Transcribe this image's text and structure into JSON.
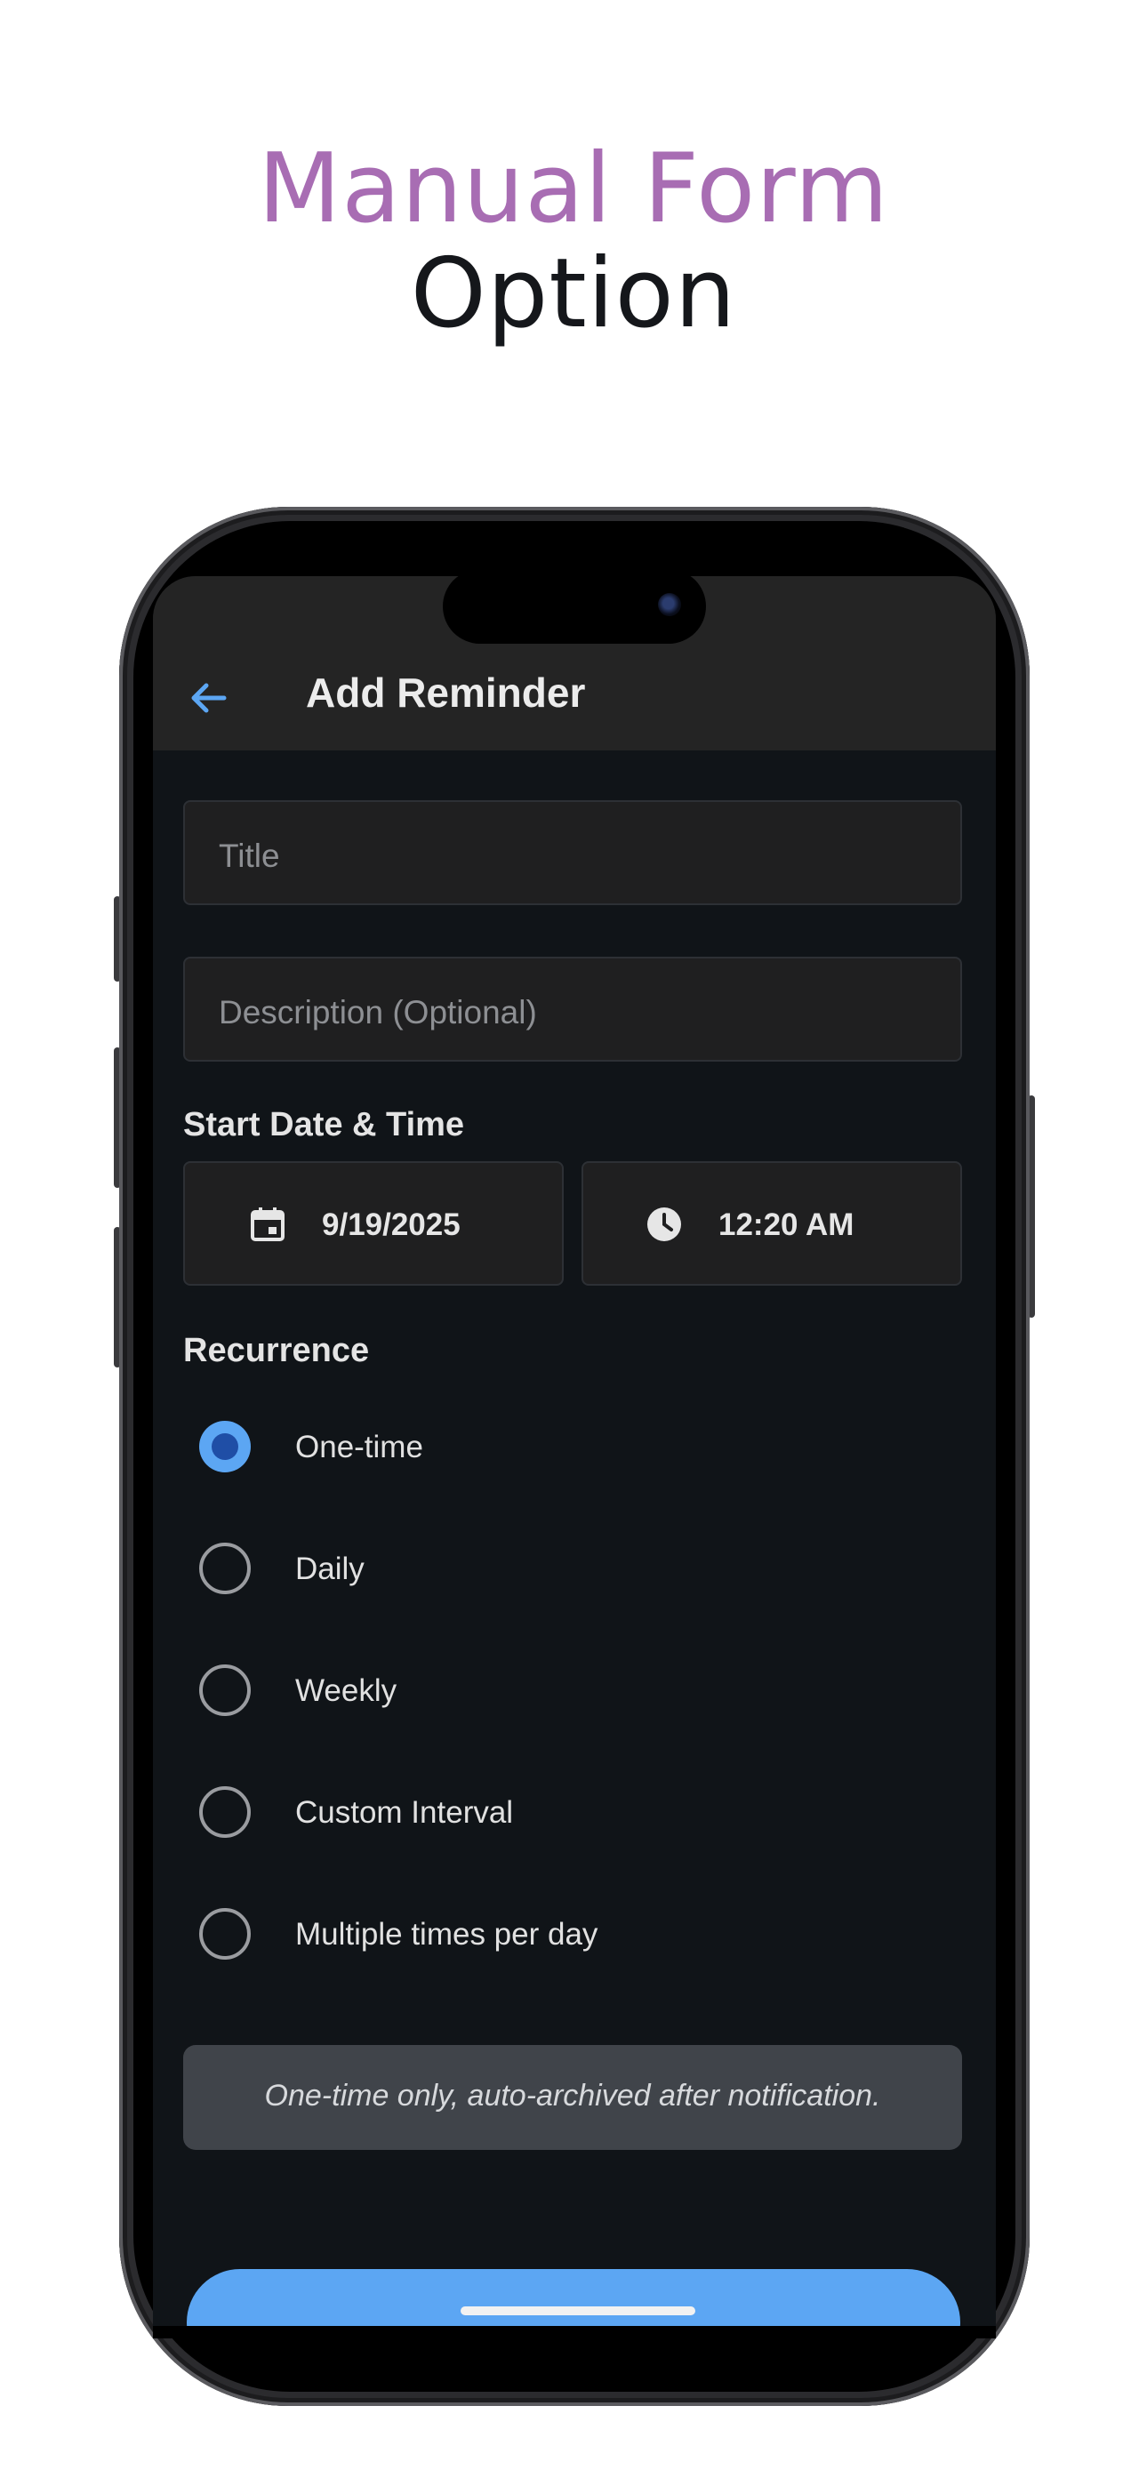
{
  "headline": {
    "line1": "Manual Form",
    "line2": "Option"
  },
  "colors": {
    "accent": "#5CA6F3",
    "headline_purple": "#A86DB3",
    "background": "#101418",
    "appbar": "#242424"
  },
  "appbar": {
    "back_icon": "arrow-left-icon",
    "title": "Add Reminder"
  },
  "form": {
    "title_placeholder": "Title",
    "description_placeholder": "Description (Optional)",
    "start_label": "Start Date & Time",
    "date": {
      "icon": "calendar-icon",
      "value": "9/19/2025"
    },
    "time": {
      "icon": "clock-icon",
      "value": "12:20 AM"
    },
    "recurrence_label": "Recurrence",
    "recurrence_options": [
      {
        "label": "One-time",
        "selected": true
      },
      {
        "label": "Daily",
        "selected": false
      },
      {
        "label": "Weekly",
        "selected": false
      },
      {
        "label": "Custom Interval",
        "selected": false
      },
      {
        "label": "Multiple times per day",
        "selected": false
      }
    ],
    "note": "One-time only, auto-archived after notification."
  }
}
